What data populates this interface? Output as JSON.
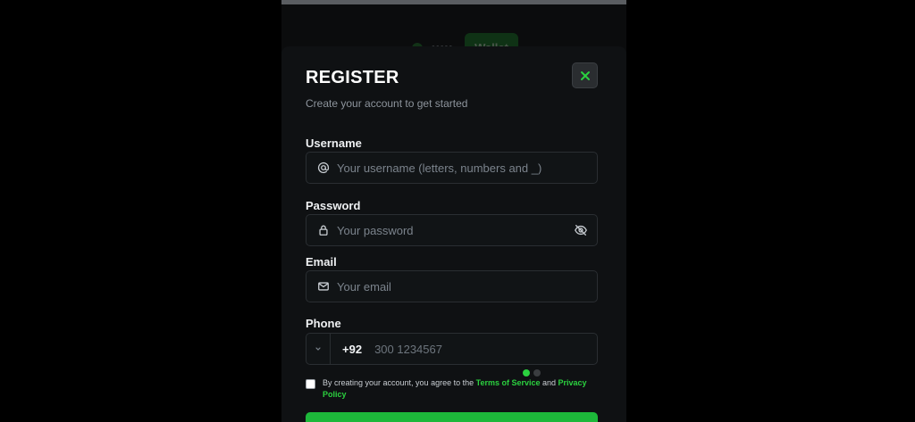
{
  "background": {
    "wallet_label": "Wallet",
    "balance_mask": "•••••"
  },
  "modal": {
    "title": "REGISTER",
    "subtitle": "Create your account to get started",
    "close_icon": "close-icon",
    "accent_color": "#2bd13f"
  },
  "fields": {
    "username": {
      "label": "Username",
      "placeholder": "Your username (letters, numbers and _)",
      "icon": "at-icon"
    },
    "password": {
      "label": "Password",
      "placeholder": "Your password",
      "icon": "lock-icon",
      "toggle_icon": "eye-off-icon"
    },
    "email": {
      "label": "Email",
      "placeholder": "Your email",
      "icon": "mail-icon"
    },
    "phone": {
      "label": "Phone",
      "country_code": "+92",
      "placeholder": "300 1234567"
    }
  },
  "terms": {
    "prefix": "By creating your account, you agree to the ",
    "tos_link": "Terms of Service",
    "connector": " and ",
    "privacy_link": "Privacy Policy",
    "checked": false
  }
}
